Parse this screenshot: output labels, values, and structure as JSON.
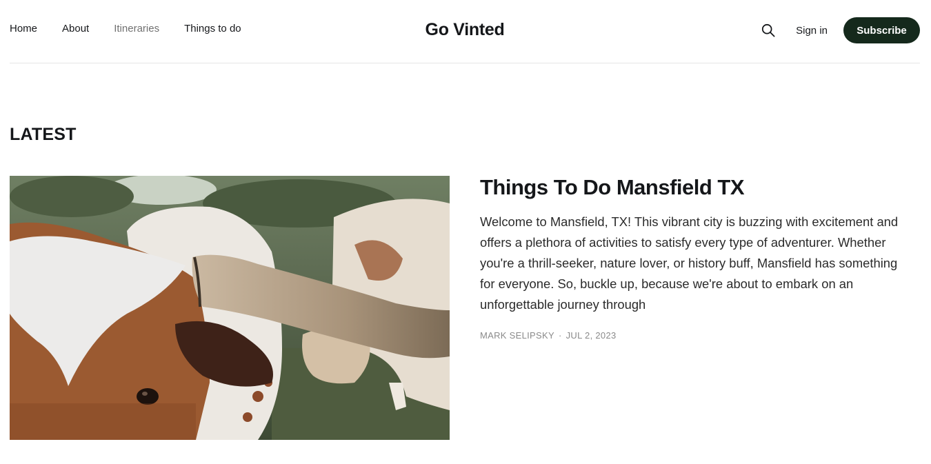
{
  "header": {
    "nav": [
      {
        "label": "Home"
      },
      {
        "label": "About"
      },
      {
        "label": "Itineraries"
      },
      {
        "label": "Things to do"
      }
    ],
    "site_title": "Go Vinted",
    "sign_in_label": "Sign in",
    "subscribe_label": "Subscribe",
    "search_icon": "search-icon"
  },
  "main": {
    "section_title": "LATEST",
    "post": {
      "title": "Things To Do Mansfield TX",
      "excerpt": "Welcome to Mansfield, TX! This vibrant city is buzzing with excitement and offers a plethora of activities to satisfy every type of adventurer. Whether you're a thrill-seeker, nature lover, or history buff, Mansfield has something for everyone. So, buckle up, because we're about to embark on an unforgettable journey through",
      "author": "MARK SELIPSKY",
      "separator": "·",
      "date": "JUL 2, 2023"
    }
  },
  "colors": {
    "subscribe_bg": "#15291c",
    "text": "#15171a",
    "muted": "#707070"
  }
}
